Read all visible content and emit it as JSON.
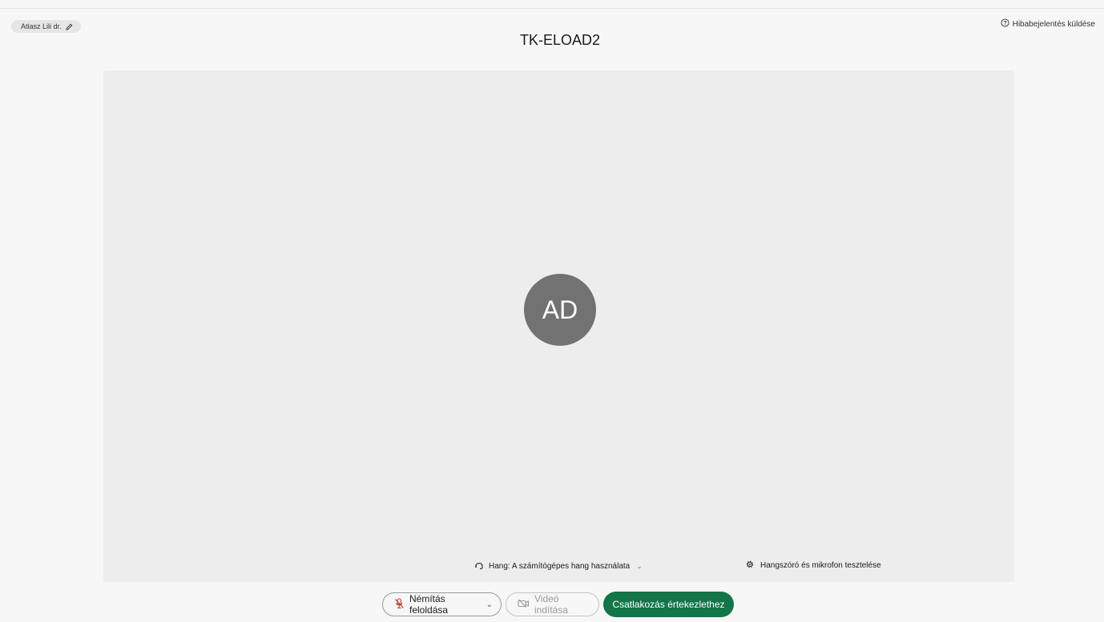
{
  "header": {
    "user_name": "Atlasz Lili dr.",
    "report_label": "Hibabejelentés küldése",
    "meeting_title": "TK-ELOAD2"
  },
  "preview": {
    "avatar_initials": "AD",
    "audio_label": "Hang: A számítógépes hang használata",
    "test_label": "Hangszóró és mikrofon tesztelése"
  },
  "controls": {
    "mute_label": "Némítás feloldása",
    "video_label": "Videó indítása",
    "join_label": "Csatlakozás értekezlethez"
  },
  "colors": {
    "join_button": "#137548",
    "avatar": "#727272",
    "mic_muted_icon": "#c0392b",
    "background": "#f7f7f7",
    "preview_background": "#ededed"
  },
  "icons": {
    "edit": "pencil-icon",
    "help": "question-circle-icon",
    "audio": "headset-icon",
    "settings": "gear-icon",
    "mic": "microphone-muted-icon",
    "video": "video-off-icon",
    "dropdown": "chevron-down-icon"
  }
}
